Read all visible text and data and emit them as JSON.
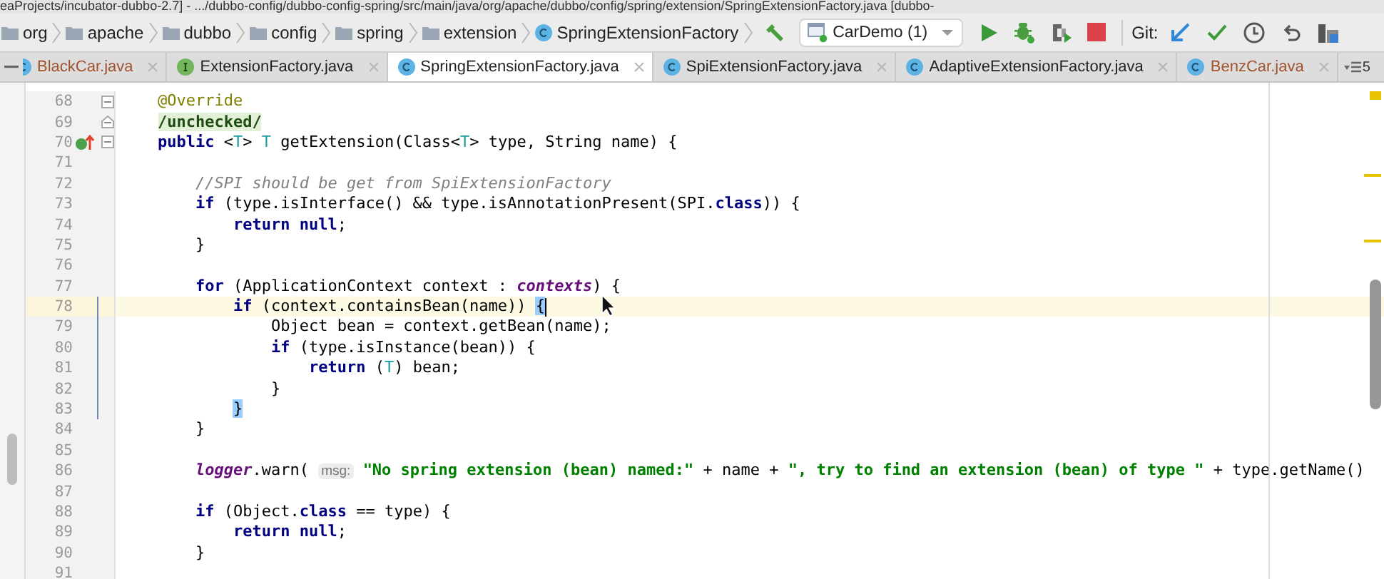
{
  "window": {
    "title": "eaProjects/incubator-dubbo-2.7] - .../dubbo-config/dubbo-config-spring/src/main/java/org/apache/dubbo/config/spring/extension/SpringExtensionFactory.java [dubbo-"
  },
  "breadcrumbs": [
    {
      "label": "org",
      "kind": "folder"
    },
    {
      "label": "apache",
      "kind": "folder"
    },
    {
      "label": "dubbo",
      "kind": "folder"
    },
    {
      "label": "config",
      "kind": "folder"
    },
    {
      "label": "spring",
      "kind": "folder"
    },
    {
      "label": "extension",
      "kind": "folder"
    },
    {
      "label": "SpringExtensionFactory",
      "kind": "class"
    }
  ],
  "toolbar": {
    "run_config": "CarDemo (1)",
    "git_label": "Git:"
  },
  "tabs": [
    {
      "label": "BlackCar.java",
      "kind": "class",
      "selected": false,
      "color": "#a0522d"
    },
    {
      "label": "ExtensionFactory.java",
      "kind": "interface",
      "selected": false,
      "color": "#222222"
    },
    {
      "label": "SpringExtensionFactory.java",
      "kind": "class",
      "selected": true,
      "color": "#222222"
    },
    {
      "label": "SpiExtensionFactory.java",
      "kind": "class",
      "selected": false,
      "color": "#222222"
    },
    {
      "label": "AdaptiveExtensionFactory.java",
      "kind": "class",
      "selected": false,
      "color": "#222222"
    },
    {
      "label": "BenzCar.java",
      "kind": "class",
      "selected": false,
      "color": "#a0522d"
    }
  ],
  "tab_overflow_count": "5",
  "lines": [
    {
      "number": "68",
      "current": false,
      "changed": false,
      "gutter": [
        {
          "kind": "fold-open"
        }
      ],
      "tokens": [
        {
          "kind": "annotation",
          "text": "    @Override"
        }
      ]
    },
    {
      "number": "69",
      "current": false,
      "changed": false,
      "gutter": [
        {
          "kind": "fold-close"
        }
      ],
      "tokens": [
        {
          "kind": "folded",
          "text": "    /unchecked/"
        }
      ]
    },
    {
      "number": "70",
      "current": false,
      "changed": false,
      "gutter": [
        {
          "kind": "override"
        },
        {
          "kind": "fold-open"
        }
      ],
      "tokens": [
        {
          "kind": "keyword",
          "text": "    public"
        },
        {
          "kind": "plain",
          "text": " <"
        },
        {
          "kind": "typeparam",
          "text": "T"
        },
        {
          "kind": "plain",
          "text": "> "
        },
        {
          "kind": "typeparam",
          "text": "T"
        },
        {
          "kind": "plain",
          "text": " getExtension(Class<"
        },
        {
          "kind": "typeparam",
          "text": "T"
        },
        {
          "kind": "plain",
          "text": "> type, String name) {"
        }
      ]
    },
    {
      "number": "71",
      "current": false,
      "changed": false
    },
    {
      "number": "72",
      "current": false,
      "changed": false,
      "tokens": [
        {
          "kind": "comment",
          "text": "        //SPI should be get from SpiExtensionFactory"
        }
      ]
    },
    {
      "number": "73",
      "current": false,
      "changed": false,
      "tokens": [
        {
          "kind": "keyword",
          "text": "        if"
        },
        {
          "kind": "plain",
          "text": " (type.isInterface() && type.isAnnotationPresent(SPI."
        },
        {
          "kind": "keyword",
          "text": "class"
        },
        {
          "kind": "plain",
          "text": ")) {"
        }
      ]
    },
    {
      "number": "74",
      "current": false,
      "changed": false,
      "tokens": [
        {
          "kind": "keyword",
          "text": "            return null"
        },
        {
          "kind": "plain",
          "text": ";"
        }
      ]
    },
    {
      "number": "75",
      "current": false,
      "changed": false,
      "tokens": [
        {
          "kind": "plain",
          "text": "        }"
        }
      ]
    },
    {
      "number": "76",
      "current": false,
      "changed": false
    },
    {
      "number": "77",
      "current": false,
      "changed": false,
      "tokens": [
        {
          "kind": "keyword",
          "text": "        for"
        },
        {
          "kind": "plain",
          "text": " (ApplicationContext context : "
        },
        {
          "kind": "field",
          "text": "contexts"
        },
        {
          "kind": "plain",
          "text": ") {"
        }
      ]
    },
    {
      "number": "78",
      "current": true,
      "changed": true,
      "caret": true,
      "tokens": [
        {
          "kind": "keyword",
          "text": "            if"
        },
        {
          "kind": "plain",
          "text": " (context.containsBean(name)) "
        },
        {
          "kind": "brace",
          "text": "{"
        }
      ]
    },
    {
      "number": "79",
      "current": false,
      "changed": true,
      "tokens": [
        {
          "kind": "plain",
          "text": "                Object bean = context.getBean(name);"
        }
      ]
    },
    {
      "number": "80",
      "current": false,
      "changed": true,
      "tokens": [
        {
          "kind": "keyword",
          "text": "                if"
        },
        {
          "kind": "plain",
          "text": " (type.isInstance(bean)) {"
        }
      ]
    },
    {
      "number": "81",
      "current": false,
      "changed": true,
      "tokens": [
        {
          "kind": "keyword",
          "text": "                    return"
        },
        {
          "kind": "plain",
          "text": " ("
        },
        {
          "kind": "typeparam",
          "text": "T"
        },
        {
          "kind": "plain",
          "text": ") bean;"
        }
      ]
    },
    {
      "number": "82",
      "current": false,
      "changed": true,
      "tokens": [
        {
          "kind": "plain",
          "text": "                }"
        }
      ]
    },
    {
      "number": "83",
      "current": false,
      "changed": true,
      "tokens": [
        {
          "kind": "brace",
          "text": "            }"
        }
      ]
    },
    {
      "number": "84",
      "current": false,
      "changed": false,
      "tokens": [
        {
          "kind": "plain",
          "text": "        }"
        }
      ]
    },
    {
      "number": "85",
      "current": false,
      "changed": false
    },
    {
      "number": "86",
      "current": false,
      "changed": false,
      "tokens": [
        {
          "kind": "field",
          "text": "        logger"
        },
        {
          "kind": "plain",
          "text": ".warn( "
        },
        {
          "kind": "hint",
          "text": "msg:"
        },
        {
          "kind": "string",
          "text": " \"No spring extension (bean) named:\""
        },
        {
          "kind": "plain",
          "text": " + name + "
        },
        {
          "kind": "string",
          "text": "\", try to find an extension (bean) of type \""
        },
        {
          "kind": "plain",
          "text": " + type.getName()"
        }
      ]
    },
    {
      "number": "87",
      "current": false,
      "changed": false
    },
    {
      "number": "88",
      "current": false,
      "changed": false,
      "tokens": [
        {
          "kind": "keyword",
          "text": "        if"
        },
        {
          "kind": "plain",
          "text": " (Object."
        },
        {
          "kind": "keyword",
          "text": "class"
        },
        {
          "kind": "plain",
          "text": " == type) {"
        }
      ]
    },
    {
      "number": "89",
      "current": false,
      "changed": false,
      "tokens": [
        {
          "kind": "keyword",
          "text": "            return null"
        },
        {
          "kind": "plain",
          "text": ";"
        }
      ]
    },
    {
      "number": "90",
      "current": false,
      "changed": false,
      "tokens": [
        {
          "kind": "plain",
          "text": "        }"
        }
      ]
    },
    {
      "number": "91",
      "current": false,
      "changed": false
    }
  ]
}
